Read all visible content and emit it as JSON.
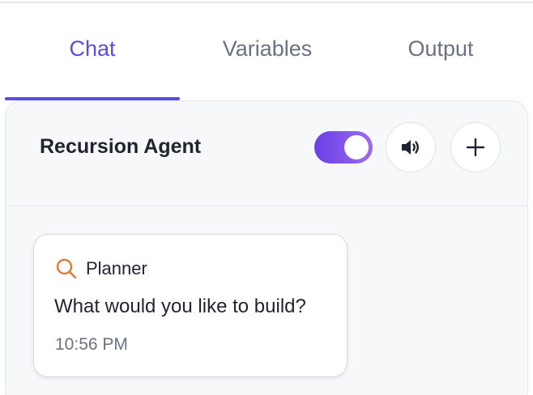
{
  "tabs": [
    {
      "label": "Chat",
      "active": true
    },
    {
      "label": "Variables",
      "active": false
    },
    {
      "label": "Output",
      "active": false
    }
  ],
  "header": {
    "agent_name": "Recursion Agent",
    "toggle_on": true,
    "sound_icon": "speaker-icon",
    "add_icon": "plus-icon"
  },
  "message": {
    "icon": "search-icon",
    "sender": "Planner",
    "text": "What would you like to build?",
    "time": "10:56 PM"
  },
  "colors": {
    "accent": "#5b4de2",
    "toggle_start": "#6a3fe6",
    "toggle_end": "#9c6cf0",
    "planner_icon": "#e07b39"
  }
}
